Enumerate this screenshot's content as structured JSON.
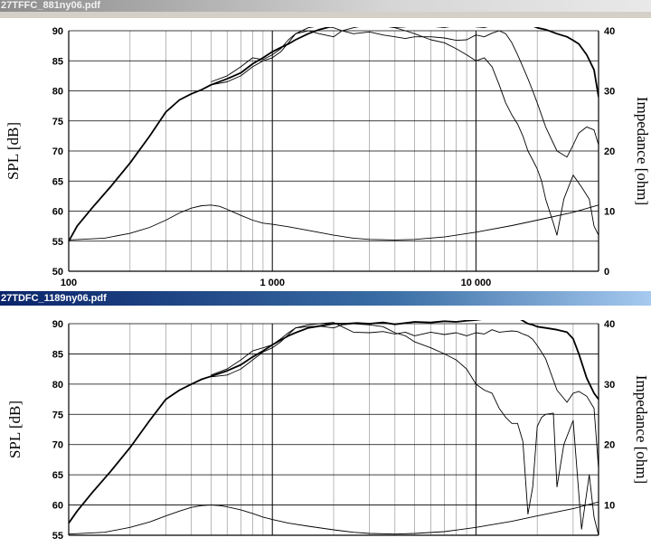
{
  "windows": [
    {
      "title": "27TFFC_881ny06.pdf"
    },
    {
      "title": "27TDFC_1189ny06.pdf"
    }
  ],
  "chart_data": [
    {
      "type": "line",
      "x_scale": "log",
      "xlim": [
        100,
        40000
      ],
      "ylim": [
        50,
        90
      ],
      "y2lim": [
        0,
        40
      ],
      "ylabel": "SPL [dB]",
      "y2label": "Impedance [ohm]",
      "x_ticks": [
        100,
        1000,
        10000
      ],
      "x_tick_labels": [
        "100",
        "1 000",
        "10 000"
      ],
      "y_ticks": [
        50,
        55,
        60,
        65,
        70,
        75,
        80,
        85,
        90
      ],
      "y2_ticks": [
        0,
        10,
        20,
        30,
        40
      ],
      "grid": true,
      "series": [
        {
          "x": [
            100,
            110,
            130,
            160,
            200,
            250,
            300,
            350,
            400,
            450,
            500,
            600,
            700,
            800,
            900,
            1000,
            1100,
            1200,
            1300,
            1500,
            1700,
            2000,
            2300,
            2600,
            3000,
            3500,
            4000,
            4500,
            5000,
            6000,
            7000,
            8000,
            9000,
            10000,
            11000,
            12000,
            13000,
            14000,
            15000,
            16000,
            17000,
            18000,
            19000,
            20000,
            22000,
            25000,
            28000,
            30000,
            32000,
            35000,
            38000,
            40000
          ],
          "y": [
            55,
            57.5,
            60.5,
            64,
            68,
            72.5,
            76.5,
            78.5,
            79.5,
            80.2,
            81,
            82,
            83,
            84.5,
            85.5,
            86.5,
            87.2,
            87.8,
            88.5,
            89.5,
            90.2,
            90.8,
            91,
            91.1,
            90.8,
            90.9,
            90.6,
            90.7,
            91,
            90.8,
            90.6,
            90.9,
            91,
            90.7,
            90.6,
            90.9,
            91,
            90.8,
            91,
            91.2,
            91,
            91.1,
            90.8,
            90.5,
            90.2,
            89.5,
            89,
            88.4,
            87.8,
            86,
            83.5,
            79
          ]
        },
        {
          "x": [
            500,
            600,
            700,
            800,
            900,
            1000,
            1100,
            1200,
            1300,
            1500,
            1700,
            2000,
            2200,
            2500,
            3000,
            3500,
            4000,
            4500,
            5000,
            6000,
            7000,
            8000,
            9000,
            10000,
            11000,
            12000,
            13000,
            14000,
            15000,
            16000,
            17000,
            18000,
            19000,
            20000,
            22000,
            25000,
            28000,
            30000,
            32000,
            35000,
            38000,
            40000
          ],
          "y": [
            81.5,
            82.5,
            84,
            85.5,
            85.2,
            86,
            87,
            88.5,
            89.5,
            90.5,
            90.8,
            90.5,
            90,
            89.5,
            89.8,
            89.3,
            89,
            88.7,
            89,
            89,
            88.8,
            88.4,
            88.5,
            89.3,
            89,
            89.6,
            90,
            89.5,
            88,
            86,
            84,
            82,
            80,
            78,
            74,
            70,
            69,
            71,
            73,
            74,
            73.5,
            71
          ]
        },
        {
          "x": [
            500,
            600,
            700,
            800,
            900,
            1000,
            1100,
            1200,
            1300,
            1500,
            1700,
            2000,
            2200,
            2500,
            3000,
            3500,
            4000,
            4500,
            5000,
            6000,
            7000,
            8000,
            9000,
            10000,
            11000,
            12000,
            13000,
            14000,
            15000,
            16000,
            17000,
            18000,
            19000,
            20000,
            21000,
            22000,
            24000,
            25000,
            27000,
            30000,
            33000,
            36000,
            38000,
            40000
          ],
          "y": [
            81,
            81.5,
            82.5,
            84,
            85,
            85.5,
            86.5,
            88,
            89.5,
            90,
            89.5,
            89,
            90,
            90.5,
            91,
            90.8,
            90.5,
            90,
            89.5,
            88.5,
            88,
            87,
            86,
            85,
            85.5,
            84,
            81,
            78,
            76,
            74.5,
            72.5,
            70,
            68.5,
            67,
            65,
            62,
            58,
            56,
            62,
            66,
            64,
            62,
            57.5,
            56
          ]
        },
        {
          "axis": "y2",
          "x": [
            100,
            150,
            200,
            250,
            300,
            350,
            400,
            450,
            500,
            550,
            600,
            700,
            800,
            900,
            1000,
            1200,
            1500,
            2000,
            2500,
            3000,
            4000,
            5000,
            7000,
            10000,
            15000,
            20000,
            30000,
            40000
          ],
          "y": [
            5.2,
            5.5,
            6.3,
            7.3,
            8.5,
            9.7,
            10.5,
            10.9,
            11,
            10.8,
            10.3,
            9.3,
            8.5,
            8,
            7.8,
            7.4,
            6.8,
            6,
            5.5,
            5.3,
            5.2,
            5.3,
            5.7,
            6.5,
            7.6,
            8.5,
            9.8,
            11
          ]
        }
      ]
    },
    {
      "type": "line",
      "x_scale": "log",
      "xlim": [
        100,
        40000
      ],
      "ylim": [
        55,
        90
      ],
      "y2lim": [
        5,
        40
      ],
      "ylabel": "SPL [dB]",
      "y2label": "Impedance [ohm]",
      "x_ticks": [
        100,
        1000,
        10000
      ],
      "x_tick_labels": [
        "",
        "",
        ""
      ],
      "y_ticks": [
        55,
        60,
        65,
        70,
        75,
        80,
        85,
        90
      ],
      "y2_ticks": [
        10,
        20,
        30,
        40
      ],
      "grid": true,
      "series": [
        {
          "x": [
            100,
            110,
            130,
            160,
            200,
            250,
            300,
            350,
            400,
            450,
            500,
            600,
            700,
            800,
            900,
            1000,
            1100,
            1200,
            1300,
            1500,
            1700,
            2000,
            2300,
            2600,
            3000,
            3500,
            4000,
            4500,
            5000,
            6000,
            7000,
            8000,
            9000,
            10000,
            11000,
            12000,
            13000,
            14000,
            15000,
            16000,
            17000,
            18000,
            19000,
            20000,
            22000,
            25000,
            28000,
            30000,
            32000,
            35000,
            38000,
            40000
          ],
          "y": [
            57,
            59,
            62,
            65.5,
            69.5,
            74,
            77.5,
            79,
            80,
            80.8,
            81.3,
            82.2,
            83.2,
            84.5,
            85.5,
            86.5,
            87.3,
            88,
            88.5,
            89.3,
            89.6,
            90,
            90,
            90.1,
            90,
            90.2,
            89.9,
            90.1,
            90.3,
            90.2,
            90.4,
            90.3,
            90.5,
            90.6,
            90.8,
            91,
            91.3,
            91.7,
            91.5,
            91,
            90.5,
            90,
            89.8,
            89.5,
            89.3,
            89,
            88.6,
            87.5,
            85,
            81,
            78.5,
            77.5
          ]
        },
        {
          "x": [
            500,
            600,
            700,
            800,
            900,
            1000,
            1100,
            1200,
            1300,
            1500,
            1700,
            2000,
            2200,
            2500,
            3000,
            3500,
            4000,
            4500,
            5000,
            6000,
            7000,
            8000,
            9000,
            10000,
            11000,
            12000,
            13000,
            14000,
            15000,
            16000,
            17000,
            18000,
            19000,
            20000,
            22000,
            25000,
            28000,
            30000,
            32000,
            35000,
            38000,
            40000
          ],
          "y": [
            81.5,
            82.5,
            84,
            85.5,
            86,
            86.5,
            87.5,
            88.5,
            89.3,
            89.8,
            90,
            90.2,
            89.5,
            88.6,
            88.5,
            88.7,
            88.3,
            88.6,
            88,
            88.6,
            88.2,
            88.5,
            88,
            88.5,
            88.3,
            89,
            88.6,
            88.7,
            88.8,
            88.7,
            88.3,
            88,
            87.4,
            86.4,
            84.2,
            79,
            77,
            78.5,
            78.8,
            78,
            76,
            66
          ]
        },
        {
          "x": [
            500,
            600,
            700,
            800,
            900,
            1000,
            1100,
            1200,
            1300,
            1500,
            1700,
            2000,
            2200,
            2500,
            3000,
            3500,
            4000,
            4500,
            5000,
            6000,
            7000,
            8000,
            9000,
            10000,
            11000,
            12000,
            13000,
            14000,
            15000,
            16000,
            17000,
            18000,
            19000,
            20000,
            21000,
            22000,
            24000,
            25000,
            27000,
            30000,
            33000,
            36000,
            38000,
            40000
          ],
          "y": [
            81.2,
            81.5,
            82.5,
            84,
            85.3,
            86,
            87,
            88.2,
            89.3,
            89.5,
            89.6,
            89.3,
            89.8,
            90,
            89.8,
            89.5,
            88.5,
            88,
            87,
            86,
            85,
            84,
            82.5,
            80,
            79,
            78.5,
            76,
            74.5,
            73.5,
            73.5,
            70.5,
            58.5,
            63,
            73,
            74.5,
            75,
            75.2,
            63,
            70,
            74,
            56,
            65,
            58,
            55
          ]
        },
        {
          "axis": "y2",
          "x": [
            100,
            150,
            200,
            250,
            300,
            350,
            400,
            450,
            500,
            550,
            600,
            700,
            800,
            900,
            1000,
            1200,
            1500,
            2000,
            2500,
            3000,
            4000,
            5000,
            7000,
            10000,
            15000,
            20000,
            30000,
            40000
          ],
          "y": [
            5.2,
            5.5,
            6.3,
            7.2,
            8.2,
            9,
            9.6,
            9.9,
            10,
            9.9,
            9.7,
            9.2,
            8.6,
            8,
            7.6,
            7,
            6.5,
            5.9,
            5.5,
            5.3,
            5.2,
            5.3,
            5.6,
            6.3,
            7.3,
            8.2,
            9.4,
            10.5
          ]
        }
      ]
    }
  ]
}
